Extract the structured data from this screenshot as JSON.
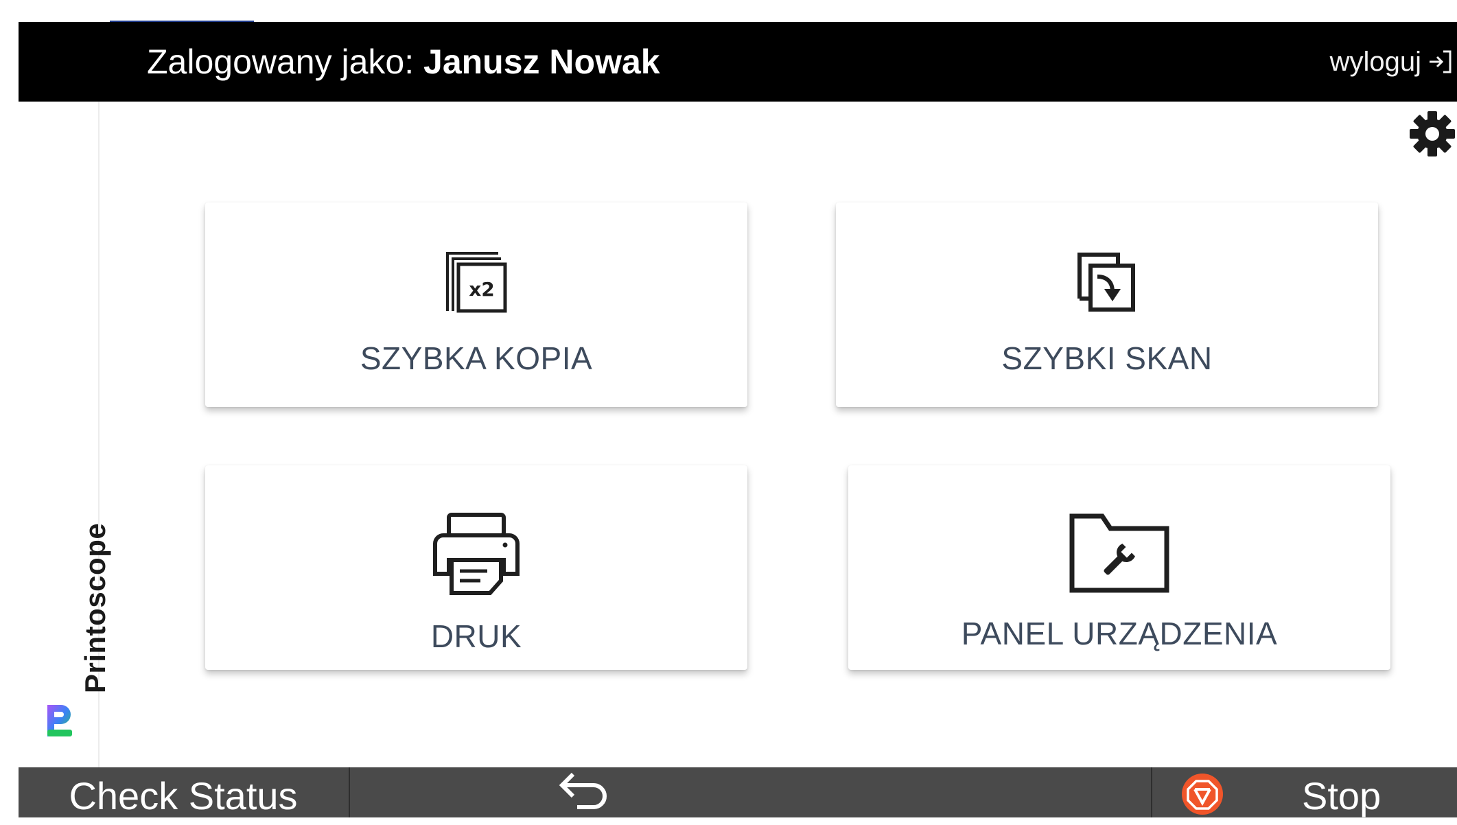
{
  "header": {
    "logged_in_prefix": "Zalogowany jako: ",
    "user_name": "Janusz Nowak",
    "logout_label": "wyloguj",
    "logout_icon": "logout-icon"
  },
  "sidebar": {
    "brand_name": "Printoscope",
    "brand_logo_icon": "printoscope-logo"
  },
  "settings": {
    "icon": "gear-icon"
  },
  "tiles": [
    {
      "label": "SZYBKA KOPIA",
      "icon": "copy-x2-icon"
    },
    {
      "label": "SZYBKI SKAN",
      "icon": "scan-icon"
    },
    {
      "label": "DRUK",
      "icon": "printer-icon"
    },
    {
      "label": "PANEL URZĄDZENIA",
      "icon": "folder-wrench-icon"
    }
  ],
  "footer": {
    "check_status_label": "Check Status",
    "back_icon": "back-arrow-icon",
    "stop_label": "Stop",
    "stop_icon": "stop-icon"
  },
  "colors": {
    "header_bg": "#000000",
    "footer_bg": "#4a4a4a",
    "tile_label": "#3d4a5c",
    "stop_accent": "#f0552a",
    "brand_gradient": [
      "#a855f7",
      "#3b82f6",
      "#22c55e"
    ]
  }
}
